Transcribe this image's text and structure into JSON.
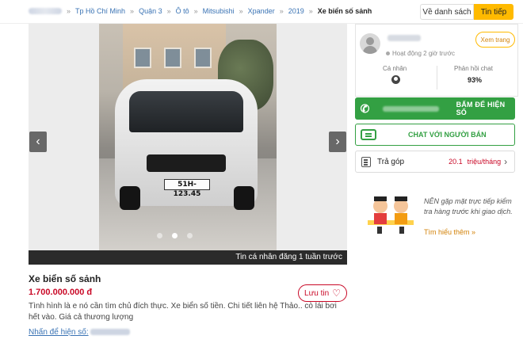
{
  "breadcrumb": {
    "items": [
      "",
      "Tp Hồ Chí Minh",
      "Quận 3",
      "Ô tô",
      "Mitsubishi",
      "Xpander",
      "2019"
    ],
    "current": "Xe biển số sảnh"
  },
  "nav": {
    "back_label": "Về danh sách",
    "next_label": "Tin tiếp"
  },
  "gallery": {
    "caption": "Tin cá nhân đăng 1 tuần trước",
    "plate": "51H-123.45",
    "left_arrow": "‹",
    "right_arrow": "›",
    "slide_count": 3,
    "active_slide": 2
  },
  "ad": {
    "title": "Xe biển số sảnh",
    "price": "1.700.000.000 đ",
    "save_label": "Lưu tin",
    "description": "Tình hình là e nó cần tìm chủ đích thực. Xe biển số tiền. Chi tiết liên hệ Thảo.. cò lái bơi hết vào. Giá cả thương lượng",
    "show_phone_label": "Nhấn để hiện số:"
  },
  "seller": {
    "activity": "Hoạt động 2 giờ trước",
    "view_shop_label": "Xem trang",
    "type_label": "Cá nhân",
    "response_label": "Phản hồi chat",
    "response_value": "93%"
  },
  "actions": {
    "call_label": "BẤM ĐỂ HIỆN SỐ",
    "chat_label": "CHAT VỚI NGƯỜI BÁN",
    "installment_label": "Trả góp",
    "installment_value": "20.1",
    "installment_unit": "triệu/tháng",
    "installment_chevron": "›"
  },
  "tip": {
    "text": "NÊN gặp mặt trực tiếp kiểm tra hàng trước khi giao dịch.",
    "link": "Tìm hiểu thêm »"
  },
  "colors": {
    "accent": "#ffba00",
    "green": "#33a043",
    "price": "#c90927",
    "link": "#3a73b4"
  }
}
